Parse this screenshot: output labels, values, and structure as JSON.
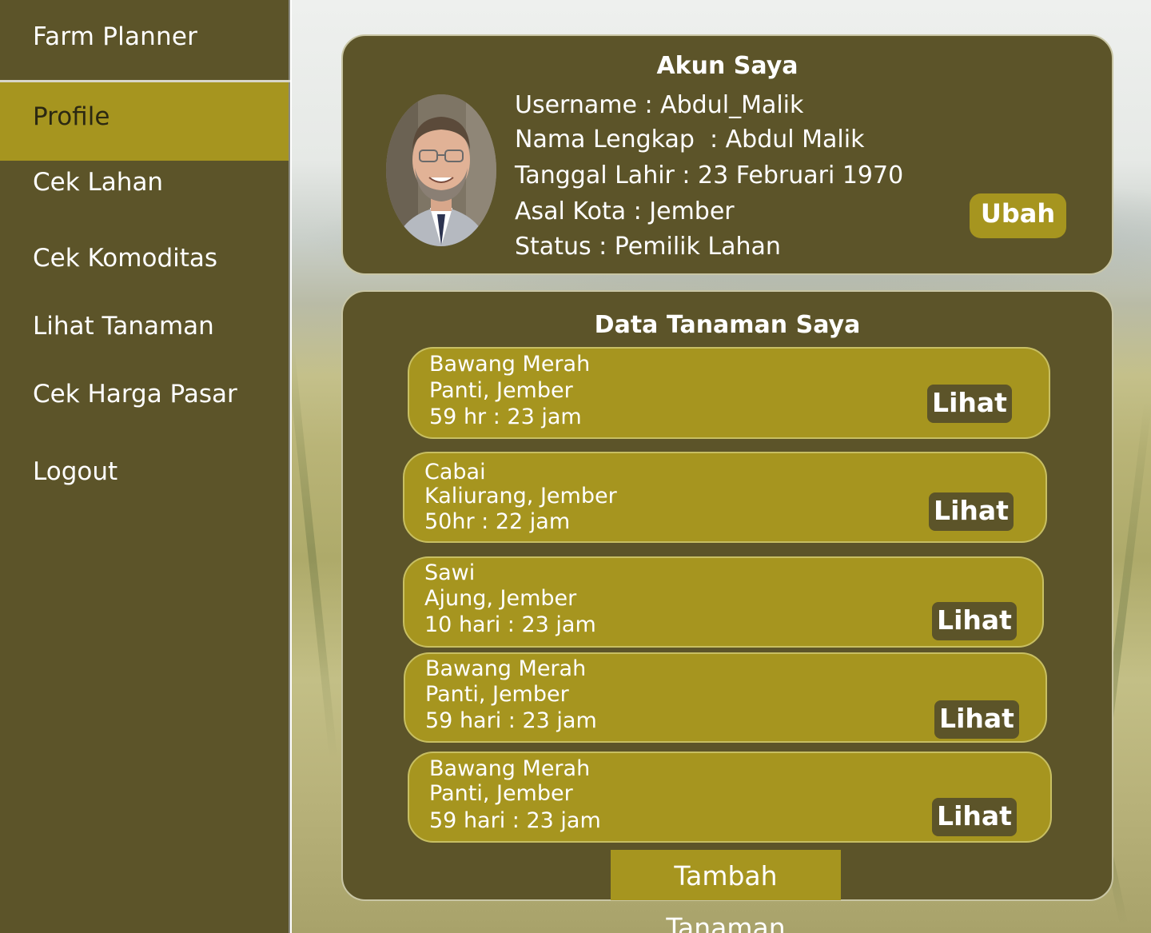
{
  "sidebar": {
    "brand": "Farm Planner",
    "items": [
      {
        "label": "Profile",
        "active": true
      },
      {
        "label": "Cek Lahan"
      },
      {
        "label": "Cek Komoditas"
      },
      {
        "label": "Lihat Tanaman"
      },
      {
        "label": "Cek Harga Pasar"
      },
      {
        "label": "Logout"
      }
    ]
  },
  "account": {
    "title": "Akun Saya",
    "lines": [
      "Username : Abdul_Malik",
      "Nama Lengkap  : Abdul Malik",
      "Tanggal Lahir : 23 Februari 1970",
      "Asal Kota : Jember",
      "Status : Pemilik Lahan"
    ],
    "edit_label": "Ubah"
  },
  "plants": {
    "title": "Data Tanaman Saya",
    "items": [
      {
        "name": "Bawang Merah",
        "location": "Panti, Jember",
        "time": "59 hr : 23 jam",
        "action": "Lihat"
      },
      {
        "name": "Cabai",
        "location": "Kaliurang, Jember",
        "time": "50hr : 22 jam",
        "action": "Lihat"
      },
      {
        "name": "Sawi",
        "location": "Ajung, Jember",
        "time": "10 hari : 23 jam",
        "action": "Lihat"
      },
      {
        "name": "Bawang Merah",
        "location": "Panti, Jember",
        "time": "59 hari : 23 jam",
        "action": "Lihat"
      },
      {
        "name": "Bawang Merah",
        "location": "Panti, Jember",
        "time": "59 hari : 23 jam",
        "action": "Lihat"
      }
    ],
    "add_label": "Tambah Tanaman"
  },
  "colors": {
    "sidebar": "#5c5429",
    "accent": "#a6951f",
    "text": "#ffffff"
  }
}
